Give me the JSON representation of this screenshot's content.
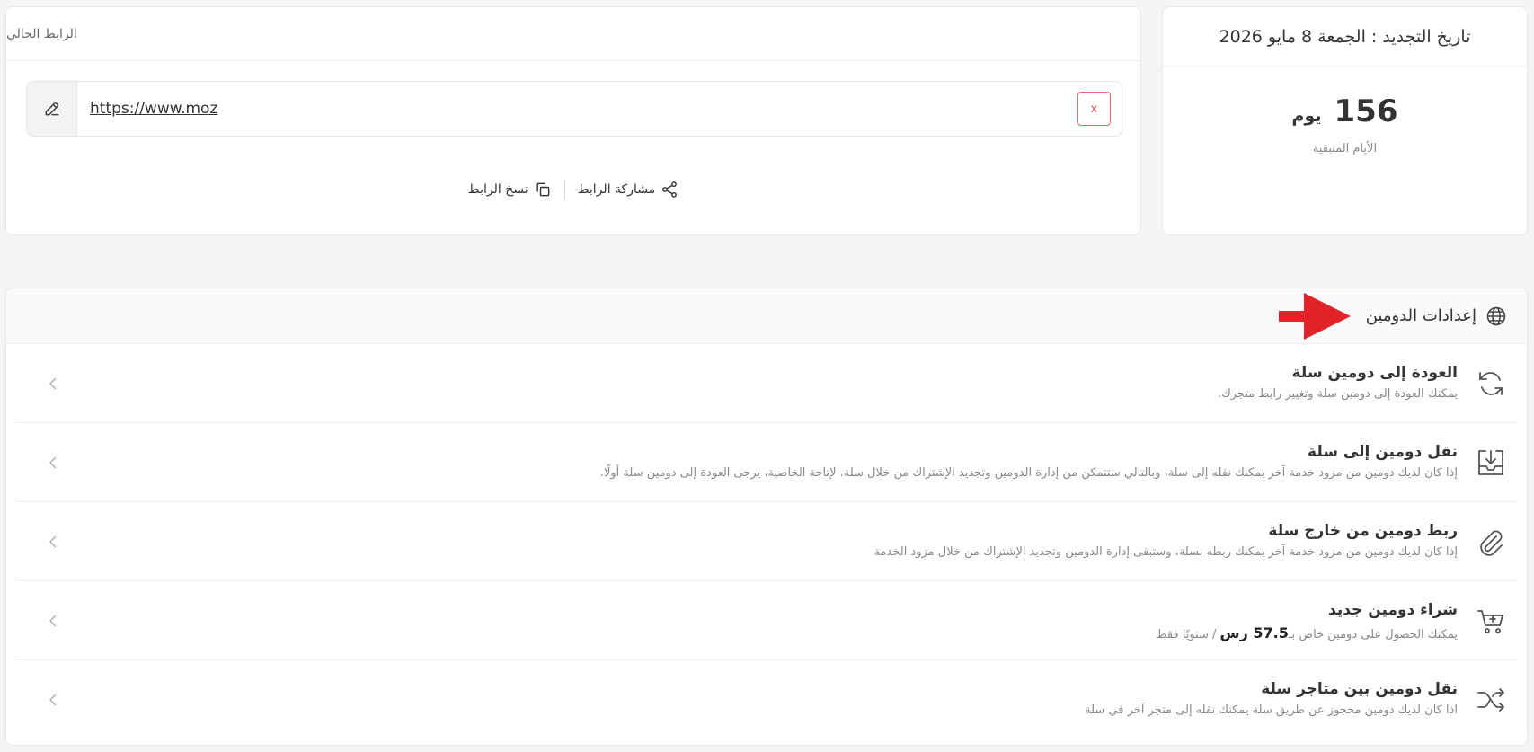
{
  "renewal": {
    "title": "تاريخ التجديد : الجمعة 8 مايو 2026",
    "days_count": "156",
    "days_unit": "يوم",
    "days_label": "الأيام المتبقية"
  },
  "current_link": {
    "title": "الرابط الحالي",
    "url": "https://www.moz",
    "clear_label": "x",
    "share_label": "مشاركة الرابط",
    "copy_label": "نسخ الرابط"
  },
  "domain_settings": {
    "title": "إعدادات الدومين",
    "items": [
      {
        "icon": "refresh-icon",
        "title": "العودة إلى دومين سلة",
        "description": "يمكنك العودة إلى دومين سلة وتغيير رابط متجرك."
      },
      {
        "icon": "inbox-download-icon",
        "title": "نقل دومين إلى سلة",
        "description": "إذا كان لديك دومين من مزود خدمة آخر يمكنك نقله إلى سلة، وبالتالي ستتمكن من إدارة الدومين وتجديد الإشتراك من خلال سلة. لإتاحة الخاصية، يرجى العودة إلى دومين سلة أولًا."
      },
      {
        "icon": "paperclip-icon",
        "title": "ربط دومين من خارج سلة",
        "description": "إذا كان لديك دومين من مزود خدمة آخر يمكنك ربطه بسلة، وستبقى إدارة الدومين وتجديد الإشتراك من خلال مزود الخدمة"
      },
      {
        "icon": "cart-add-icon",
        "title": "شراء دومين جديد",
        "description_prefix": "يمكنك الحصول على دومين خاص بـ",
        "price": "57.5 رس",
        "description_suffix": " / سنويًا فقط"
      },
      {
        "icon": "shuffle-icon",
        "title": "نقل دومين بين متاجر سلة",
        "description": "اذا كان لديك دومين محجوز عن طريق سلة يمكنك نقله إلى متجر آخر في سلة"
      }
    ]
  },
  "colors": {
    "accent_red": "#e3222a",
    "danger": "#e05050",
    "text": "#333333",
    "muted": "#888888"
  }
}
